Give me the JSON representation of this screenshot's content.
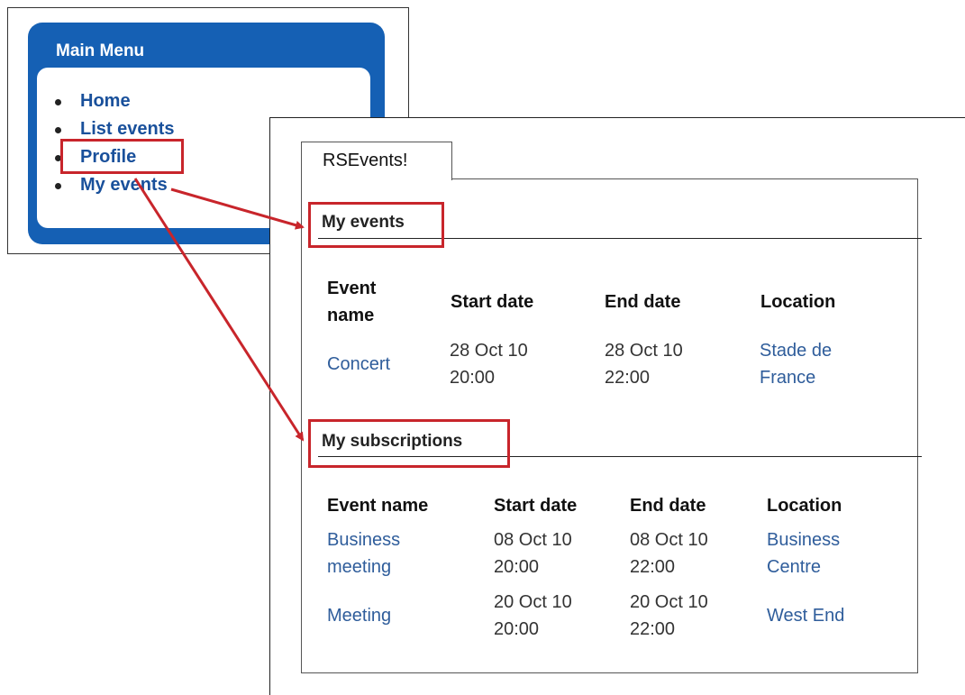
{
  "menu": {
    "title": "Main Menu",
    "items": [
      {
        "label": "Home"
      },
      {
        "label": "List events"
      },
      {
        "label": "Profile"
      },
      {
        "label": "My events"
      }
    ]
  },
  "events": {
    "tab_label": "RSEvents!",
    "my_events": {
      "title": "My events",
      "columns": [
        "Event\nname",
        "Start date",
        "End date",
        "Location"
      ],
      "rows": [
        {
          "name": "Concert",
          "start": "28 Oct 10\n20:00",
          "end": "28 Oct 10\n22:00",
          "location": "Stade de\nFrance"
        }
      ]
    },
    "my_subscriptions": {
      "title": "My subscriptions",
      "columns": [
        "Event name",
        "Start date",
        "End date",
        "Location"
      ],
      "rows": [
        {
          "name": "Business\nmeeting",
          "start": "08 Oct 10\n20:00",
          "end": "08 Oct 10\n22:00",
          "location": "Business\nCentre"
        },
        {
          "name": "Meeting",
          "start": "20 Oct 10\n20:00",
          "end": "20 Oct 10\n22:00",
          "location": "West End"
        }
      ]
    }
  },
  "colors": {
    "annotation": "#c8252b",
    "menu_blue": "#1560b4",
    "link": "#2f5d9b"
  }
}
